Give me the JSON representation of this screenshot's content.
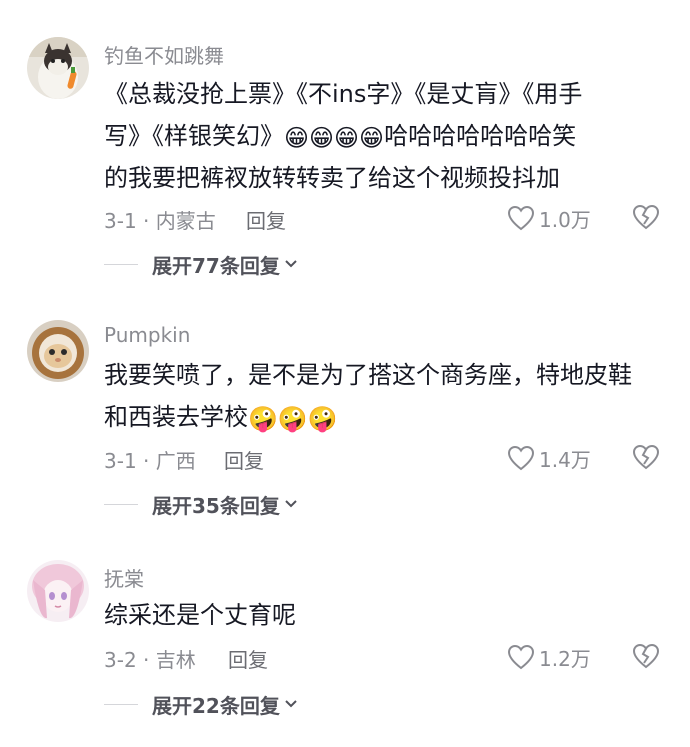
{
  "comments": [
    {
      "username": "钓鱼不如跳舞",
      "text_line1": "《总裁没抢上票》《不ins字》《是丈肓》《用手",
      "text_line2a": "写》《样银笑幻》",
      "emoji_a": "😁😁😁😁",
      "text_line2b": "哈哈哈哈哈哈哈笑",
      "text_line3": "的我要把裤衩放转转卖了给这个视频投抖加",
      "date_location": "3-1 · 内蒙古",
      "reply_label": "回复",
      "likes": "1.0万",
      "expand_label": "展开77条回复"
    },
    {
      "username": "Pumpkin",
      "text_line1": "我要笑喷了，是不是为了搭这个商务座，特地皮鞋",
      "text_line2a": "和西装去学校",
      "emoji_a": "🤪🤪🤪",
      "date_location": "3-1 · 广西",
      "reply_label": "回复",
      "likes": "1.4万",
      "expand_label": "展开35条回复"
    },
    {
      "username": "抚棠",
      "text_line1": "综采还是个丈育呢",
      "date_location": "3-2 · 吉林",
      "reply_label": "回复",
      "likes": "1.2万",
      "expand_label": "展开22条回复"
    }
  ],
  "icons": {
    "like": "heart-outline-icon",
    "dislike": "broken-heart-icon",
    "expand": "chevron-down-icon"
  },
  "colors": {
    "text": "#161823",
    "secondary": "#8a8b91",
    "expand": "#51525a"
  }
}
